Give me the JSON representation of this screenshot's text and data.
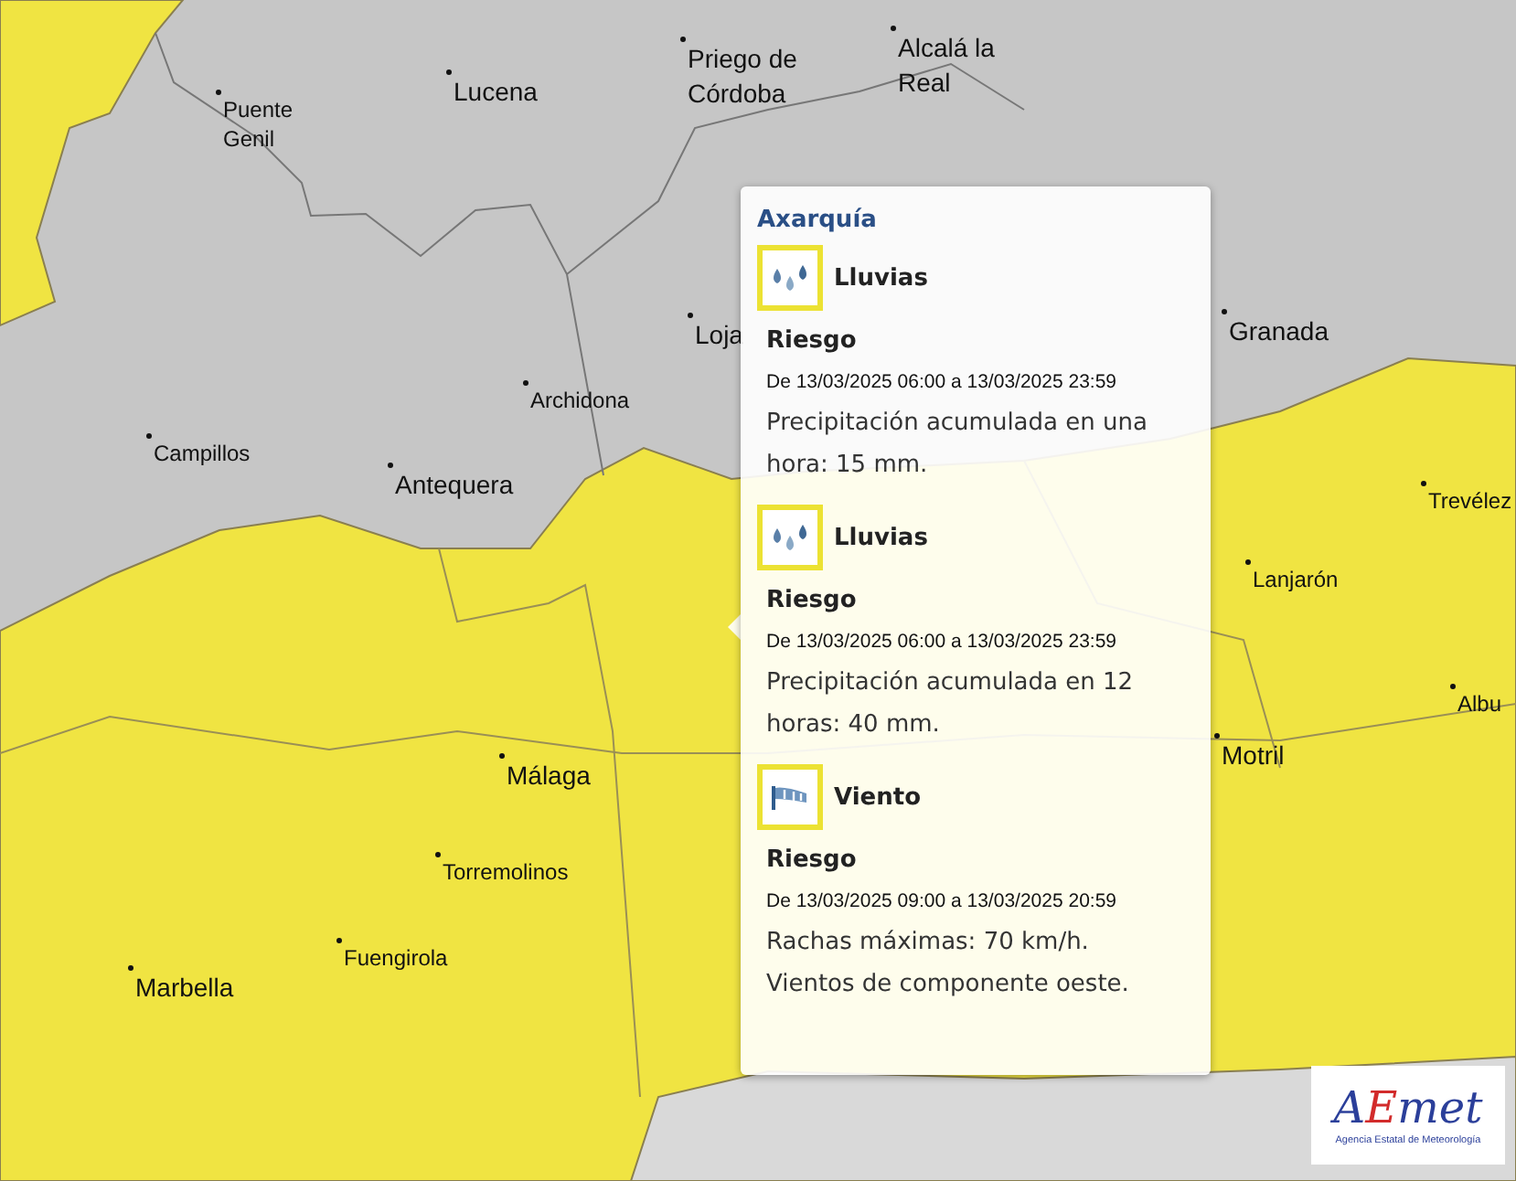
{
  "map": {
    "cities": [
      {
        "name": "Puente Genil",
        "kind": "minor"
      },
      {
        "name": "Lucena",
        "kind": "major"
      },
      {
        "name": "Priego de Córdoba",
        "kind": "major"
      },
      {
        "name": "Alcalá la Real",
        "kind": "major"
      },
      {
        "name": "Loja",
        "kind": "major"
      },
      {
        "name": "Granada",
        "kind": "major"
      },
      {
        "name": "Archidona",
        "kind": "minor"
      },
      {
        "name": "Campillos",
        "kind": "minor"
      },
      {
        "name": "Antequera",
        "kind": "major"
      },
      {
        "name": "Trevélez",
        "kind": "minor"
      },
      {
        "name": "Lanjarón",
        "kind": "minor"
      },
      {
        "name": "Motril",
        "kind": "major"
      },
      {
        "name": "Albu",
        "kind": "minor"
      },
      {
        "name": "Málaga",
        "kind": "major"
      },
      {
        "name": "Torremolinos",
        "kind": "minor"
      },
      {
        "name": "Fuengirola",
        "kind": "minor"
      },
      {
        "name": "Marbella",
        "kind": "major"
      }
    ]
  },
  "popup": {
    "title": "Axarquía",
    "warnings": [
      {
        "kind": "rain",
        "phenomenon": "Lluvias",
        "level_label": "Riesgo",
        "period": "De 13/03/2025 06:00 a 13/03/2025 23:59",
        "description": "Precipitación acumulada en una hora: 15 mm."
      },
      {
        "kind": "rain",
        "phenomenon": "Lluvias",
        "level_label": "Riesgo",
        "period": "De 13/03/2025 06:00 a 13/03/2025 23:59",
        "description": "Precipitación acumulada en 12 horas: 40 mm."
      },
      {
        "kind": "wind",
        "phenomenon": "Viento",
        "level_label": "Riesgo",
        "period": "De 13/03/2025 09:00 a 13/03/2025 20:59",
        "description": "Rachas máximas: 70 km/h. Vientos de componente oeste."
      }
    ]
  },
  "logo": {
    "wordmark": "AEmet",
    "subtitle": "Agencia Estatal de Meteorología"
  }
}
